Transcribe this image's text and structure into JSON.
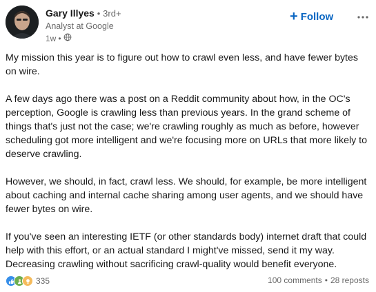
{
  "author": {
    "name": "Gary Illyes",
    "degree_separator": "•",
    "degree": "3rd+",
    "headline": "Analyst at Google",
    "posted": "1w",
    "time_separator": "•",
    "visibility_icon": "globe-icon"
  },
  "actions": {
    "follow_label": "Follow",
    "follow_icon": "plus-icon",
    "more_icon": "more-dots-icon"
  },
  "post": {
    "paragraphs": [
      "My mission this year is to figure out how to crawl even less, and have fewer bytes on wire.",
      "A few days ago there was a post on a Reddit community about how, in the OC's perception, Google is crawling less than previous years. In the grand scheme of things that's just not the case; we're crawling roughly as much as before, however scheduling got more intelligent and we're focusing more on URLs that more likely to deserve crawling.",
      "However, we should, in fact, crawl less. We should, for example, be more intelligent about caching and internal cache sharing among user agents, and we should have fewer bytes on wire.",
      "If you've seen an interesting IETF (or other standards body) internet draft that could help with this effort, or an actual standard I might've missed, send it my way. Decreasing crawling without sacrificing crawl-quality would benefit everyone."
    ]
  },
  "social": {
    "reaction_icons": [
      "like-icon",
      "celebrate-icon",
      "insightful-icon"
    ],
    "reaction_count": "335",
    "comments": "100 comments",
    "separator": "•",
    "reposts": "28 reposts"
  },
  "colors": {
    "accent": "#0a66c2",
    "like": "#378fe9",
    "celebrate": "#6dae4f",
    "insightful": "#f5bb5c"
  }
}
